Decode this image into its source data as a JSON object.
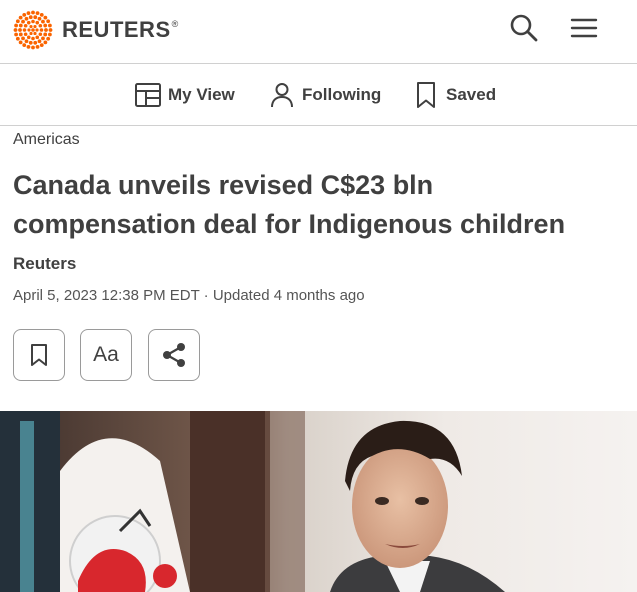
{
  "header": {
    "brand": "REUTERS",
    "trademark": "®",
    "search_icon": "search-icon",
    "menu_icon": "hamburger-menu-icon"
  },
  "subnav": {
    "items": [
      {
        "label": "My View",
        "icon": "my-view-icon"
      },
      {
        "label": "Following",
        "icon": "person-icon"
      },
      {
        "label": "Saved",
        "icon": "bookmark-icon"
      }
    ]
  },
  "article": {
    "section": "Americas",
    "headline": "Canada unveils revised C$23 bln compensation deal for Indigenous children",
    "author": "Reuters",
    "dateline": "April 5, 2023 12:38 PM EDT · Updated 4 months ago"
  },
  "tools": {
    "bookmark_icon": "bookmark-icon",
    "text_size_label": "Aa",
    "share_icon": "share-icon"
  },
  "colors": {
    "brand_orange": "#fa6400",
    "text": "#404040",
    "divider": "#d0d0d0"
  }
}
